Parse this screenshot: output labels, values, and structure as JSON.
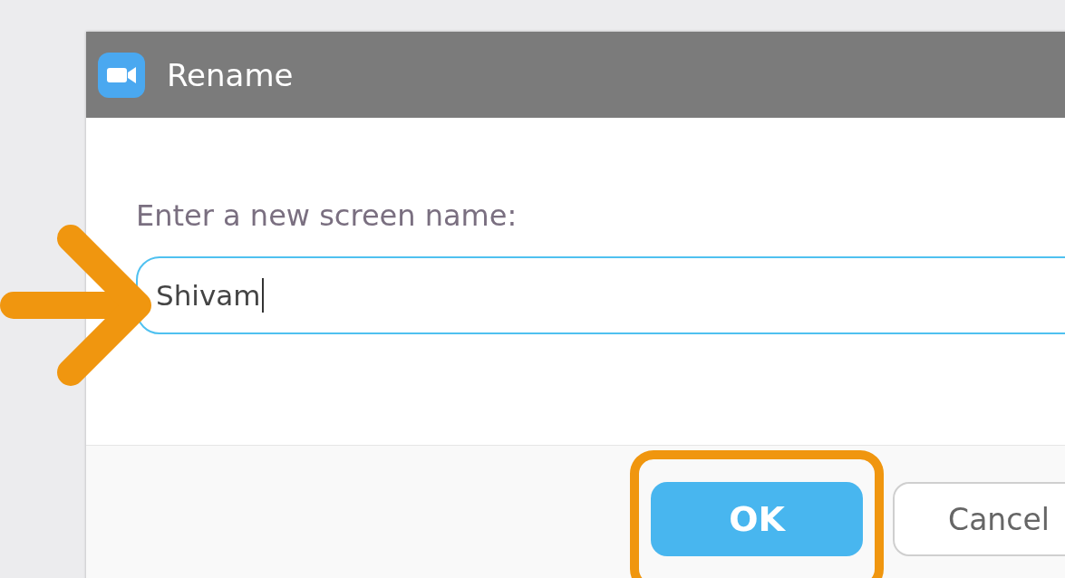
{
  "window": {
    "title": "Rename"
  },
  "prompt": "Enter a new screen name:",
  "name_field": {
    "value": "Shivam",
    "highlighted": true
  },
  "buttons": [
    {
      "label": "OK",
      "kind": "primary",
      "highlighted": true
    },
    {
      "label": "Cancel",
      "kind": "secondary",
      "highlighted": false
    }
  ]
}
